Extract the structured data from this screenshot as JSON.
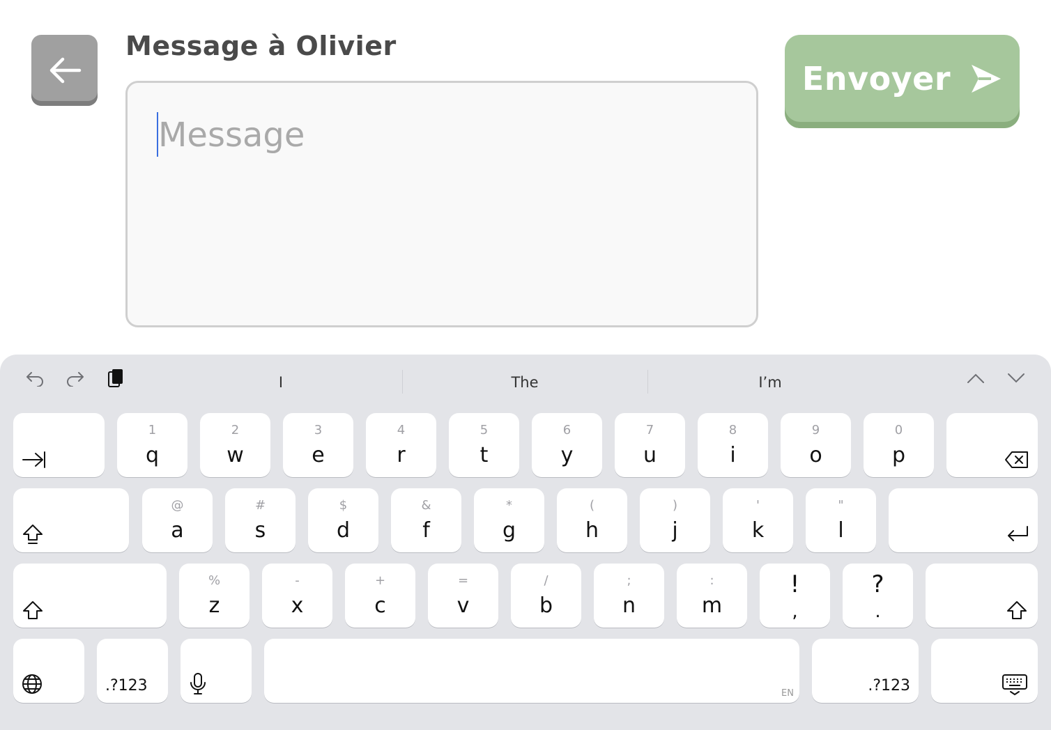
{
  "header": {
    "title": "Message à Olivier",
    "send_label": "Envoyer"
  },
  "message": {
    "placeholder": "Message",
    "value": ""
  },
  "keyboard": {
    "suggestions": [
      "I",
      "The",
      "I’m"
    ],
    "row1": [
      {
        "sec": "1",
        "pri": "q"
      },
      {
        "sec": "2",
        "pri": "w"
      },
      {
        "sec": "3",
        "pri": "e"
      },
      {
        "sec": "4",
        "pri": "r"
      },
      {
        "sec": "5",
        "pri": "t"
      },
      {
        "sec": "6",
        "pri": "y"
      },
      {
        "sec": "7",
        "pri": "u"
      },
      {
        "sec": "8",
        "pri": "i"
      },
      {
        "sec": "9",
        "pri": "o"
      },
      {
        "sec": "0",
        "pri": "p"
      }
    ],
    "row2": [
      {
        "sec": "@",
        "pri": "a"
      },
      {
        "sec": "#",
        "pri": "s"
      },
      {
        "sec": "$",
        "pri": "d"
      },
      {
        "sec": "&",
        "pri": "f"
      },
      {
        "sec": "*",
        "pri": "g"
      },
      {
        "sec": "(",
        "pri": "h"
      },
      {
        "sec": ")",
        "pri": "j"
      },
      {
        "sec": "'",
        "pri": "k"
      },
      {
        "sec": "\"",
        "pri": "l"
      }
    ],
    "row3": [
      {
        "sec": "%",
        "pri": "z"
      },
      {
        "sec": "-",
        "pri": "x"
      },
      {
        "sec": "+",
        "pri": "c"
      },
      {
        "sec": "=",
        "pri": "v"
      },
      {
        "sec": "/",
        "pri": "b"
      },
      {
        "sec": ";",
        "pri": "n"
      },
      {
        "sec": ":",
        "pri": "m"
      }
    ],
    "punct": [
      {
        "top": "!",
        "bottom": ","
      },
      {
        "top": "?",
        "bottom": "."
      }
    ],
    "numbers_label": ".?123",
    "language_label": "EN"
  }
}
